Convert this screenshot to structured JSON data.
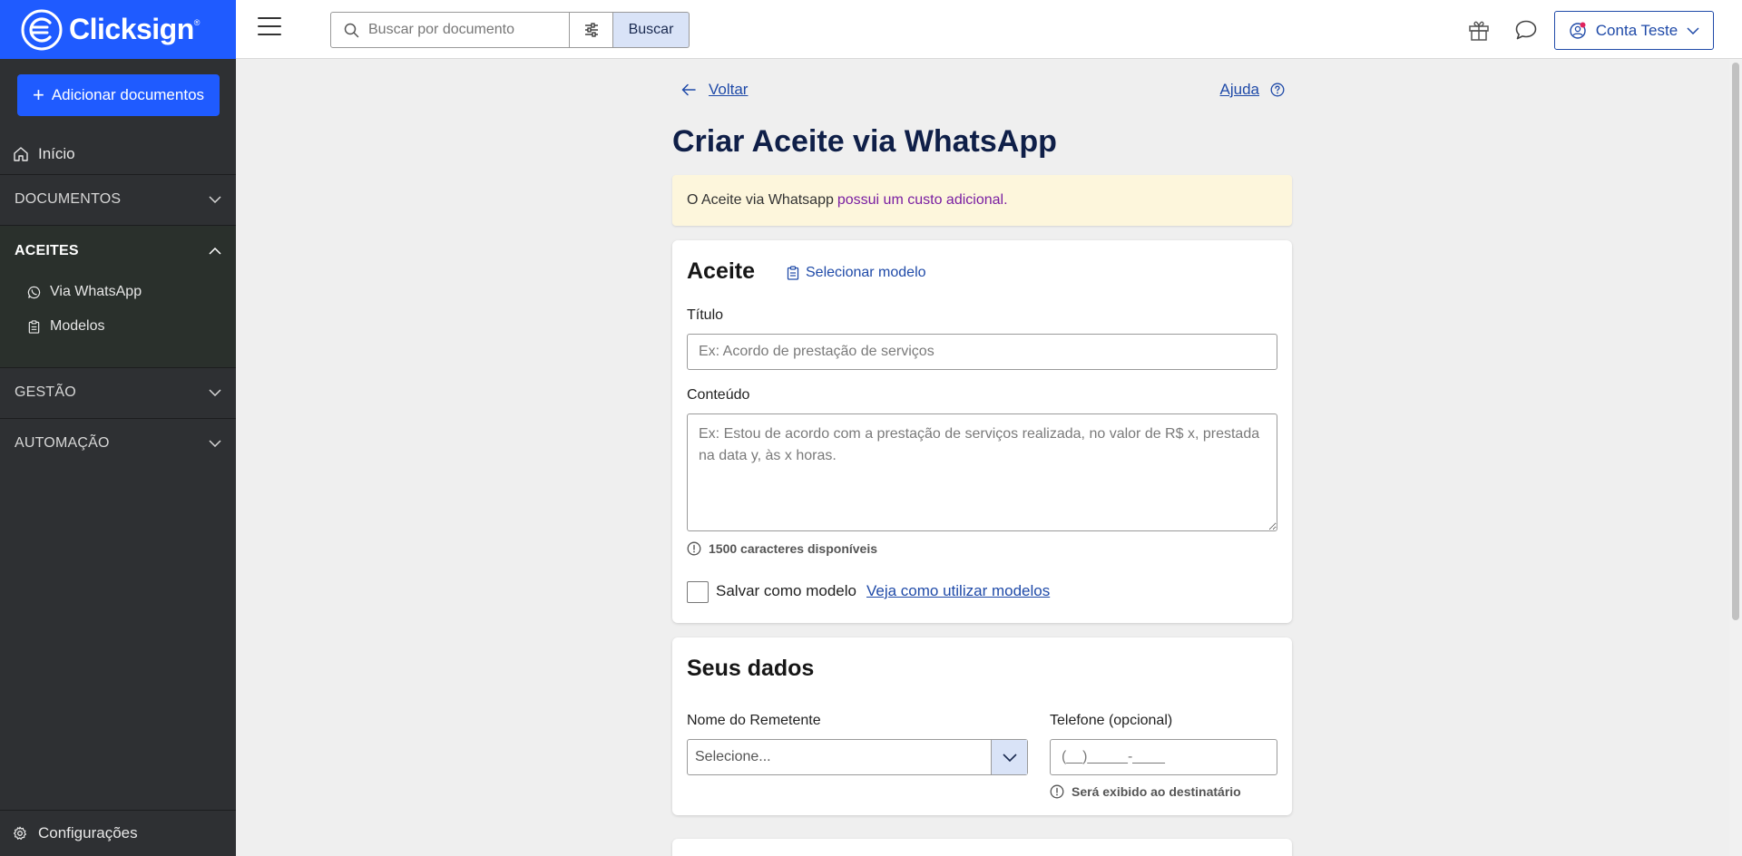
{
  "brand": {
    "name": "Clicksign",
    "trademark": "®",
    "color": "#1f5bff"
  },
  "sidebar": {
    "add_button": "Adicionar documentos",
    "home": "Início",
    "sections": {
      "documentos": "DOCUMENTOS",
      "aceites": "ACEITES",
      "gestao": "GESTÃO",
      "automacao": "AUTOMAÇÃO"
    },
    "aceites_items": {
      "whatsapp": "Via WhatsApp",
      "modelos": "Modelos"
    },
    "settings": "Configurações"
  },
  "header": {
    "search_placeholder": "Buscar por documento",
    "search_button": "Buscar",
    "account_label": "Conta Teste"
  },
  "page": {
    "back": "Voltar",
    "help": "Ajuda",
    "title": "Criar Aceite via WhatsApp",
    "notice_text": "O Aceite via Whatsapp",
    "notice_accent": "possui um custo adicional."
  },
  "aceite_card": {
    "title": "Aceite",
    "select_model": "Selecionar modelo",
    "title_label": "Título",
    "title_placeholder": "Ex: Acordo de prestação de serviços",
    "content_label": "Conteúdo",
    "content_placeholder": "Ex: Estou de acordo com a prestação de serviços realizada, no valor de R$ x, prestada na data y, às x horas.",
    "chars_hint": "1500 caracteres disponíveis",
    "save_as_model": "Salvar como modelo",
    "how_to_use_models": "Veja como utilizar modelos"
  },
  "data_card": {
    "title": "Seus dados",
    "sender_label": "Nome do Remetente",
    "sender_placeholder": "Selecione...",
    "phone_label": "Telefone (opcional)",
    "phone_placeholder": "(__)_____-____",
    "phone_hint": "Será exibido ao destinatário"
  }
}
